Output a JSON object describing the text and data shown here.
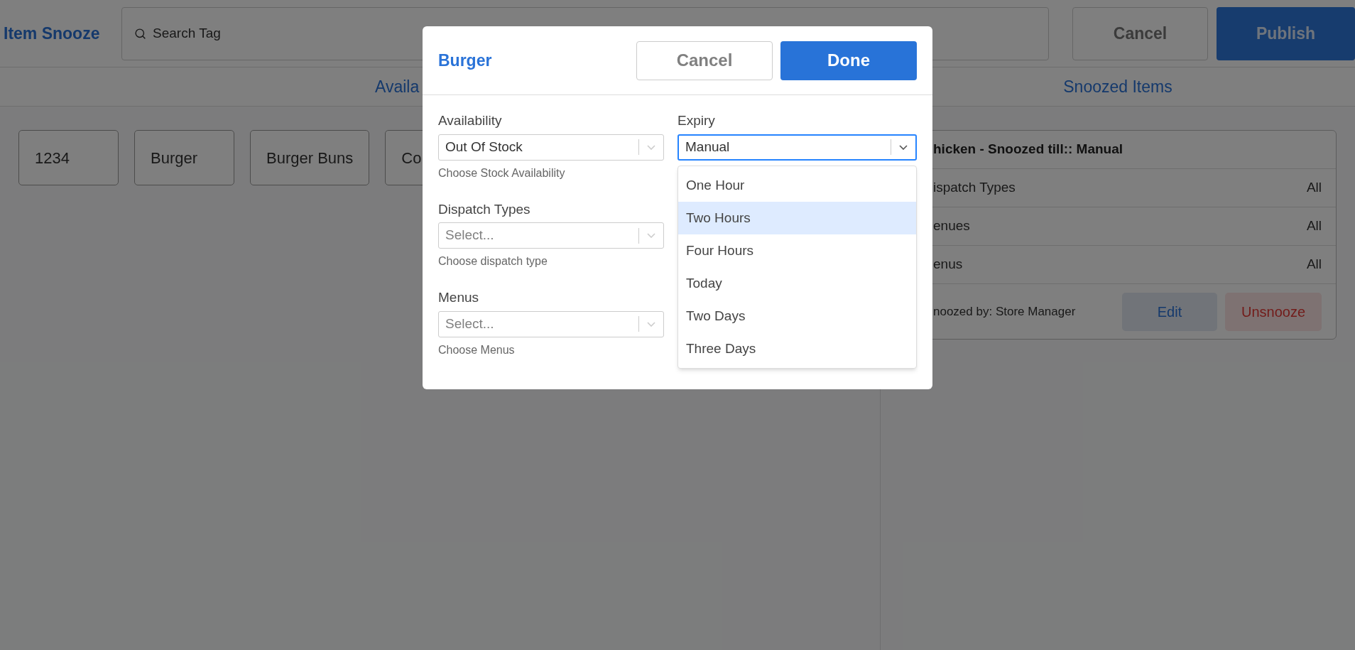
{
  "header": {
    "title": "Item Snooze",
    "search_placeholder": "Search Tag",
    "cancel": "Cancel",
    "publish": "Publish"
  },
  "tabs": [
    {
      "label": "Availa"
    },
    {
      "label": "Snoozed Items"
    }
  ],
  "items": [
    "1234",
    "Burger",
    "Burger Buns",
    "Co"
  ],
  "snoozed_card": {
    "title": "hicken - Snoozed till:: Manual",
    "rows": [
      {
        "label": "ispatch Types",
        "value": "All"
      },
      {
        "label": "enues",
        "value": "All"
      },
      {
        "label": "enus",
        "value": "All"
      }
    ],
    "footer": "noozed by: Store Manager",
    "edit": "Edit",
    "unsnooze": "Unsnooze"
  },
  "modal": {
    "title": "Burger",
    "cancel": "Cancel",
    "done": "Done",
    "fields": [
      {
        "label": "Availability",
        "value": "Out Of Stock",
        "help": "Choose Stock Availability"
      },
      {
        "label": "Dispatch Types",
        "placeholder": "Select...",
        "help": "Choose dispatch type"
      },
      {
        "label": "Menus",
        "placeholder": "Select...",
        "help": "Choose Menus"
      }
    ],
    "expiry": {
      "label": "Expiry",
      "value": "Manual",
      "expanded": true,
      "options": [
        {
          "label": "One Hour",
          "selected": false
        },
        {
          "label": "Two Hours",
          "selected": true
        },
        {
          "label": "Four Hours",
          "selected": false
        },
        {
          "label": "Today",
          "selected": false
        },
        {
          "label": "Two Days",
          "selected": false
        },
        {
          "label": "Three Days",
          "selected": false
        }
      ]
    }
  }
}
